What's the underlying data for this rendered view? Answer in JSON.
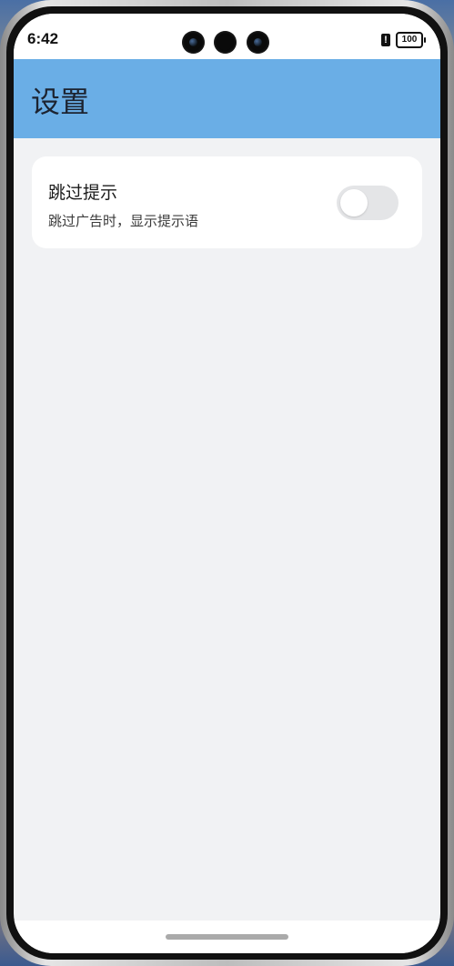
{
  "status_bar": {
    "time": "6:42",
    "alert_glyph": "!",
    "battery_level": "100",
    "icons": [
      "alert-icon",
      "battery-icon"
    ]
  },
  "app_bar": {
    "title": "设置",
    "color": "#6aaee6"
  },
  "settings": {
    "items": [
      {
        "title": "跳过提示",
        "subtitle": "跳过广告时，显示提示语",
        "toggle_on": false
      }
    ]
  },
  "colors": {
    "background": "#f1f2f4",
    "card": "#ffffff",
    "toggle_off": "#e4e5e7"
  }
}
